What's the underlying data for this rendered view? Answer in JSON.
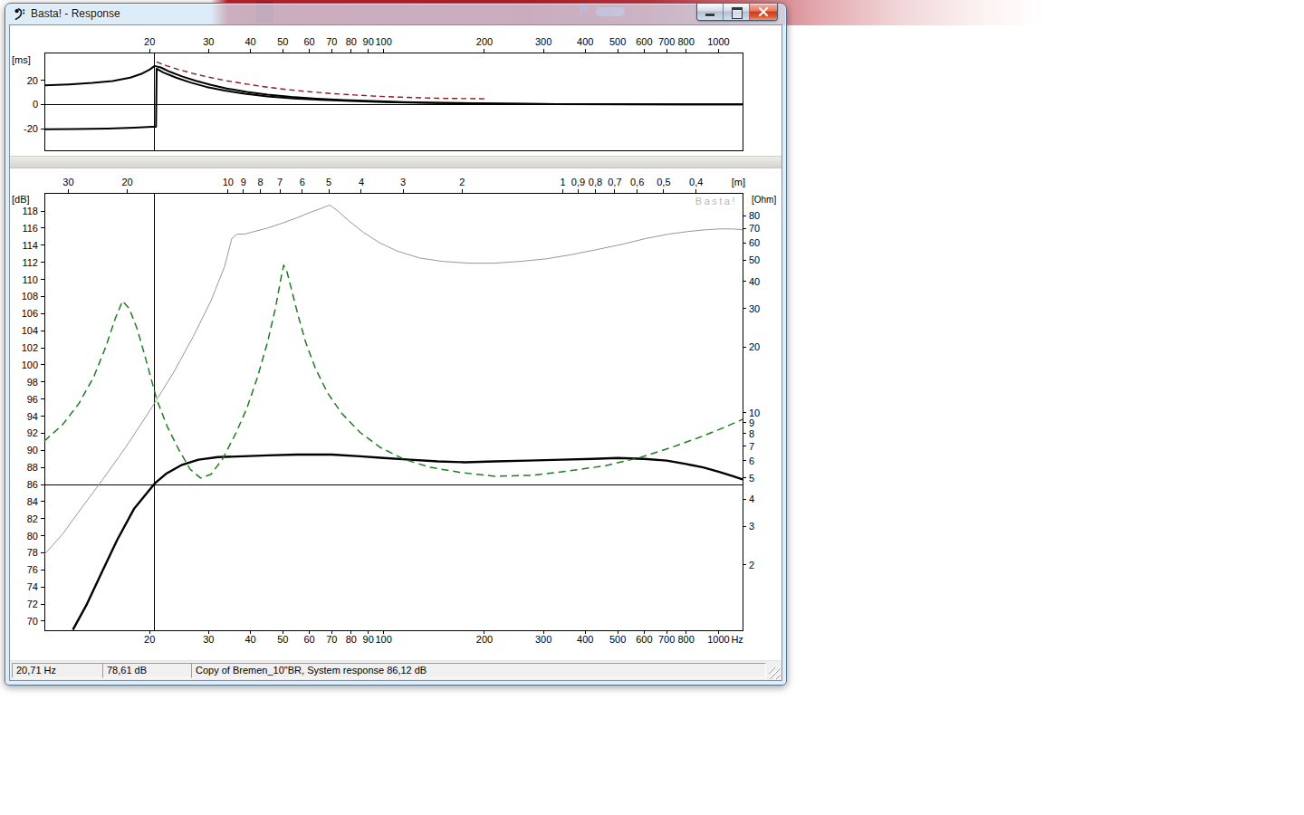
{
  "window": {
    "title": "Basta! - Response"
  },
  "background": {
    "badge_letter": "P"
  },
  "status_bar": {
    "cursor_freq": "20,71 Hz",
    "cursor_level": "78,61 dB",
    "message": "Copy of Bremen_10\"BR, System response 86,12 dB"
  },
  "icons": {
    "app": "bass-clef-icon",
    "minimize": "minimize-icon",
    "maximize": "maximize-icon",
    "close": "close-icon",
    "resize": "resize-grip-icon"
  },
  "colors": {
    "banner_red": "#b81f2e",
    "impedance_green": "#1e7d1e",
    "reference_dark_red": "#8b1a1a",
    "gray_curve": "#989898",
    "watermark_gray": "#b7b7b7"
  },
  "chart_data": [
    {
      "type": "line",
      "name": "group-delay-panel",
      "x_scale": "log",
      "x_range_hz": [
        9.7,
        1180
      ],
      "x_ticks": [
        20,
        30,
        40,
        50,
        60,
        70,
        80,
        90,
        100,
        200,
        300,
        400,
        500,
        600,
        700,
        800,
        1000
      ],
      "y_axis_label": "[ms]",
      "y_ticks": [
        20,
        0,
        -20
      ],
      "y_range_ms": [
        -38,
        43
      ],
      "cursor_hz": 20.71,
      "series": [
        {
          "name": "system-delay",
          "color": "#000000",
          "width": 2,
          "dash": null,
          "points": [
            [
              9.7,
              15.8
            ],
            [
              11.5,
              16.6
            ],
            [
              13.5,
              17.8
            ],
            [
              15.5,
              19.4
            ],
            [
              17.5,
              22.2
            ],
            [
              19,
              25.6
            ],
            [
              20,
              28.8
            ],
            [
              20.7,
              31.8
            ],
            [
              21.6,
              30.6
            ],
            [
              23,
              27
            ],
            [
              25,
              23.2
            ],
            [
              27.5,
              19.6
            ],
            [
              30.5,
              16.2
            ],
            [
              34,
              13.2
            ],
            [
              39,
              10.4
            ],
            [
              45,
              8.1
            ],
            [
              53,
              6.2
            ],
            [
              63,
              4.8
            ],
            [
              76,
              3.7
            ],
            [
              92,
              2.8
            ],
            [
              115,
              2.0
            ],
            [
              145,
              1.4
            ],
            [
              185,
              1.0
            ],
            [
              240,
              0.6
            ],
            [
              330,
              0.35
            ],
            [
              500,
              0.15
            ],
            [
              800,
              0.07
            ],
            [
              1180,
              0.04
            ]
          ]
        },
        {
          "name": "wrapped-delay",
          "color": "#000000",
          "width": 2,
          "dash": null,
          "points": [
            [
              9.7,
              -20.6
            ],
            [
              12,
              -20.4
            ],
            [
              15,
              -19.9
            ],
            [
              18,
              -19.2
            ],
            [
              20.3,
              -18.6
            ],
            [
              20.9,
              -18.4
            ],
            [
              21.0,
              29.6
            ],
            [
              22,
              26.4
            ],
            [
              24,
              22.2
            ],
            [
              26.5,
              18.2
            ],
            [
              29.5,
              14.6
            ],
            [
              33.5,
              11.4
            ],
            [
              38.5,
              8.8
            ],
            [
              45,
              6.7
            ],
            [
              54,
              5.0
            ],
            [
              65,
              3.8
            ],
            [
              80,
              2.8
            ],
            [
              100,
              2.0
            ],
            [
              128,
              1.4
            ],
            [
              165,
              0.95
            ],
            [
              220,
              0.6
            ],
            [
              320,
              0.3
            ],
            [
              520,
              0.12
            ],
            [
              1180,
              0.03
            ]
          ]
        },
        {
          "name": "reference-delay",
          "color": "#8b1a1a",
          "width": 1.4,
          "dash": "6,4",
          "points": [
            [
              21,
              35.2
            ],
            [
              22.5,
              32
            ],
            [
              24.5,
              28.8
            ],
            [
              27,
              25.6
            ],
            [
              30,
              22.6
            ],
            [
              34,
              19.6
            ],
            [
              39,
              16.8
            ],
            [
              45,
              14.3
            ],
            [
              52,
              12.2
            ],
            [
              60,
              10.5
            ],
            [
              70,
              9.0
            ],
            [
              82,
              7.8
            ],
            [
              96,
              6.8
            ],
            [
              112,
              6.0
            ],
            [
              132,
              5.4
            ],
            [
              155,
              5.0
            ],
            [
              180,
              4.8
            ],
            [
              200,
              4.7
            ]
          ]
        }
      ]
    },
    {
      "type": "line",
      "name": "response-panel",
      "x_scale": "log",
      "x_range_hz": [
        9.7,
        1180
      ],
      "x_ticks": [
        20,
        30,
        40,
        50,
        60,
        70,
        80,
        90,
        100,
        200,
        300,
        400,
        500,
        600,
        700,
        800,
        1000
      ],
      "x_unit": "Hz",
      "top_axis_label": "[m]",
      "wavelength_ticks_m": [
        30,
        20,
        10,
        9,
        8,
        7,
        6,
        5,
        4,
        3,
        2,
        1,
        0.9,
        0.8,
        0.7,
        0.6,
        0.5,
        0.4
      ],
      "speed_of_sound": 343,
      "left_axis_label": "[dB]",
      "db_ticks": [
        118,
        116,
        114,
        112,
        110,
        108,
        106,
        104,
        102,
        100,
        98,
        96,
        94,
        92,
        90,
        88,
        86,
        84,
        82,
        80,
        78,
        76,
        74,
        72,
        70
      ],
      "db_range": [
        68.94,
        120.12
      ],
      "right_axis_label": "[Ohm]",
      "ohm_ticks": [
        80,
        70,
        60,
        50,
        40,
        30,
        20,
        10,
        9,
        8,
        7,
        6,
        5,
        4,
        3,
        2
      ],
      "ohm_range": [
        1.0,
        102
      ],
      "watermark": "Basta!",
      "reference_line_db": 86,
      "cursor_hz": 20.71,
      "series": [
        {
          "name": "spl-response",
          "axis": "db",
          "color": "#000000",
          "width": 2.4,
          "dash": null,
          "points": [
            [
              11.8,
              69
            ],
            [
              13,
              72
            ],
            [
              14.5,
              76
            ],
            [
              16,
              79.5
            ],
            [
              18,
              83.2
            ],
            [
              20.71,
              86.12
            ],
            [
              22.5,
              87.3
            ],
            [
              25,
              88.3
            ],
            [
              28,
              88.9
            ],
            [
              32,
              89.2
            ],
            [
              38,
              89.3
            ],
            [
              45,
              89.4
            ],
            [
              55,
              89.5
            ],
            [
              70,
              89.5
            ],
            [
              85,
              89.3
            ],
            [
              100,
              89.1
            ],
            [
              120,
              88.9
            ],
            [
              145,
              88.7
            ],
            [
              175,
              88.6
            ],
            [
              215,
              88.7
            ],
            [
              270,
              88.8
            ],
            [
              340,
              88.9
            ],
            [
              420,
              89.0
            ],
            [
              500,
              89.1
            ],
            [
              600,
              89.0
            ],
            [
              700,
              88.8
            ],
            [
              800,
              88.4
            ],
            [
              900,
              88.0
            ],
            [
              1000,
              87.5
            ],
            [
              1100,
              87.0
            ],
            [
              1180,
              86.6
            ]
          ]
        },
        {
          "name": "impedance",
          "axis": "ohm",
          "color": "#1e7d1e",
          "width": 1.5,
          "dash": "8,5",
          "points": [
            [
              9.7,
              7.4
            ],
            [
              11,
              8.8
            ],
            [
              12.3,
              11
            ],
            [
              13.6,
              14.5
            ],
            [
              14.8,
              20
            ],
            [
              15.8,
              27
            ],
            [
              16.6,
              32.5
            ],
            [
              17.4,
              30
            ],
            [
              18.4,
              24
            ],
            [
              19.6,
              17
            ],
            [
              21,
              11.5
            ],
            [
              22.6,
              8.6
            ],
            [
              24.4,
              6.8
            ],
            [
              26.4,
              5.5
            ],
            [
              28.4,
              5.0
            ],
            [
              30.5,
              5.2
            ],
            [
              33,
              6.1
            ],
            [
              36,
              7.9
            ],
            [
              39,
              10.4
            ],
            [
              42,
              14.5
            ],
            [
              45,
              21
            ],
            [
              47.5,
              30
            ],
            [
              49.3,
              41
            ],
            [
              50.3,
              47.5
            ],
            [
              51.5,
              44
            ],
            [
              53,
              37
            ],
            [
              55.5,
              28
            ],
            [
              58.5,
              21
            ],
            [
              62.5,
              16
            ],
            [
              68,
              12.3
            ],
            [
              75,
              9.9
            ],
            [
              85,
              8.1
            ],
            [
              98,
              6.9
            ],
            [
              115,
              6.1
            ],
            [
              138,
              5.6
            ],
            [
              170,
              5.3
            ],
            [
              215,
              5.1
            ],
            [
              280,
              5.15
            ],
            [
              360,
              5.4
            ],
            [
              460,
              5.7
            ],
            [
              580,
              6.2
            ],
            [
              720,
              6.9
            ],
            [
              880,
              7.7
            ],
            [
              1050,
              8.6
            ],
            [
              1180,
              9.3
            ]
          ]
        },
        {
          "name": "max-spl",
          "axis": "db",
          "color": "#989898",
          "width": 1,
          "dash": null,
          "points": [
            [
              9.7,
              77.8
            ],
            [
              11,
              80.2
            ],
            [
              12.5,
              83.2
            ],
            [
              14.5,
              86.6
            ],
            [
              17,
              90.4
            ],
            [
              20,
              94.6
            ],
            [
              23.5,
              99
            ],
            [
              27,
              103.3
            ],
            [
              30.5,
              107.5
            ],
            [
              33.5,
              111.5
            ],
            [
              35.2,
              114.8
            ],
            [
              36.5,
              115.3
            ],
            [
              38.5,
              115.3
            ],
            [
              41,
              115.6
            ],
            [
              45,
              116
            ],
            [
              50,
              116.6
            ],
            [
              55,
              117.2
            ],
            [
              60,
              117.8
            ],
            [
              65,
              118.3
            ],
            [
              69,
              118.7
            ],
            [
              73,
              118
            ],
            [
              79,
              116.8
            ],
            [
              87,
              115.5
            ],
            [
              97,
              114.3
            ],
            [
              110,
              113.3
            ],
            [
              128,
              112.5
            ],
            [
              150,
              112.1
            ],
            [
              180,
              111.9
            ],
            [
              215,
              111.9
            ],
            [
              255,
              112.1
            ],
            [
              305,
              112.4
            ],
            [
              365,
              112.9
            ],
            [
              435,
              113.5
            ],
            [
              515,
              114.1
            ],
            [
              610,
              114.8
            ],
            [
              710,
              115.3
            ],
            [
              810,
              115.6
            ],
            [
              910,
              115.8
            ],
            [
              1010,
              115.9
            ],
            [
              1100,
              115.9
            ],
            [
              1180,
              115.8
            ]
          ]
        }
      ]
    }
  ]
}
